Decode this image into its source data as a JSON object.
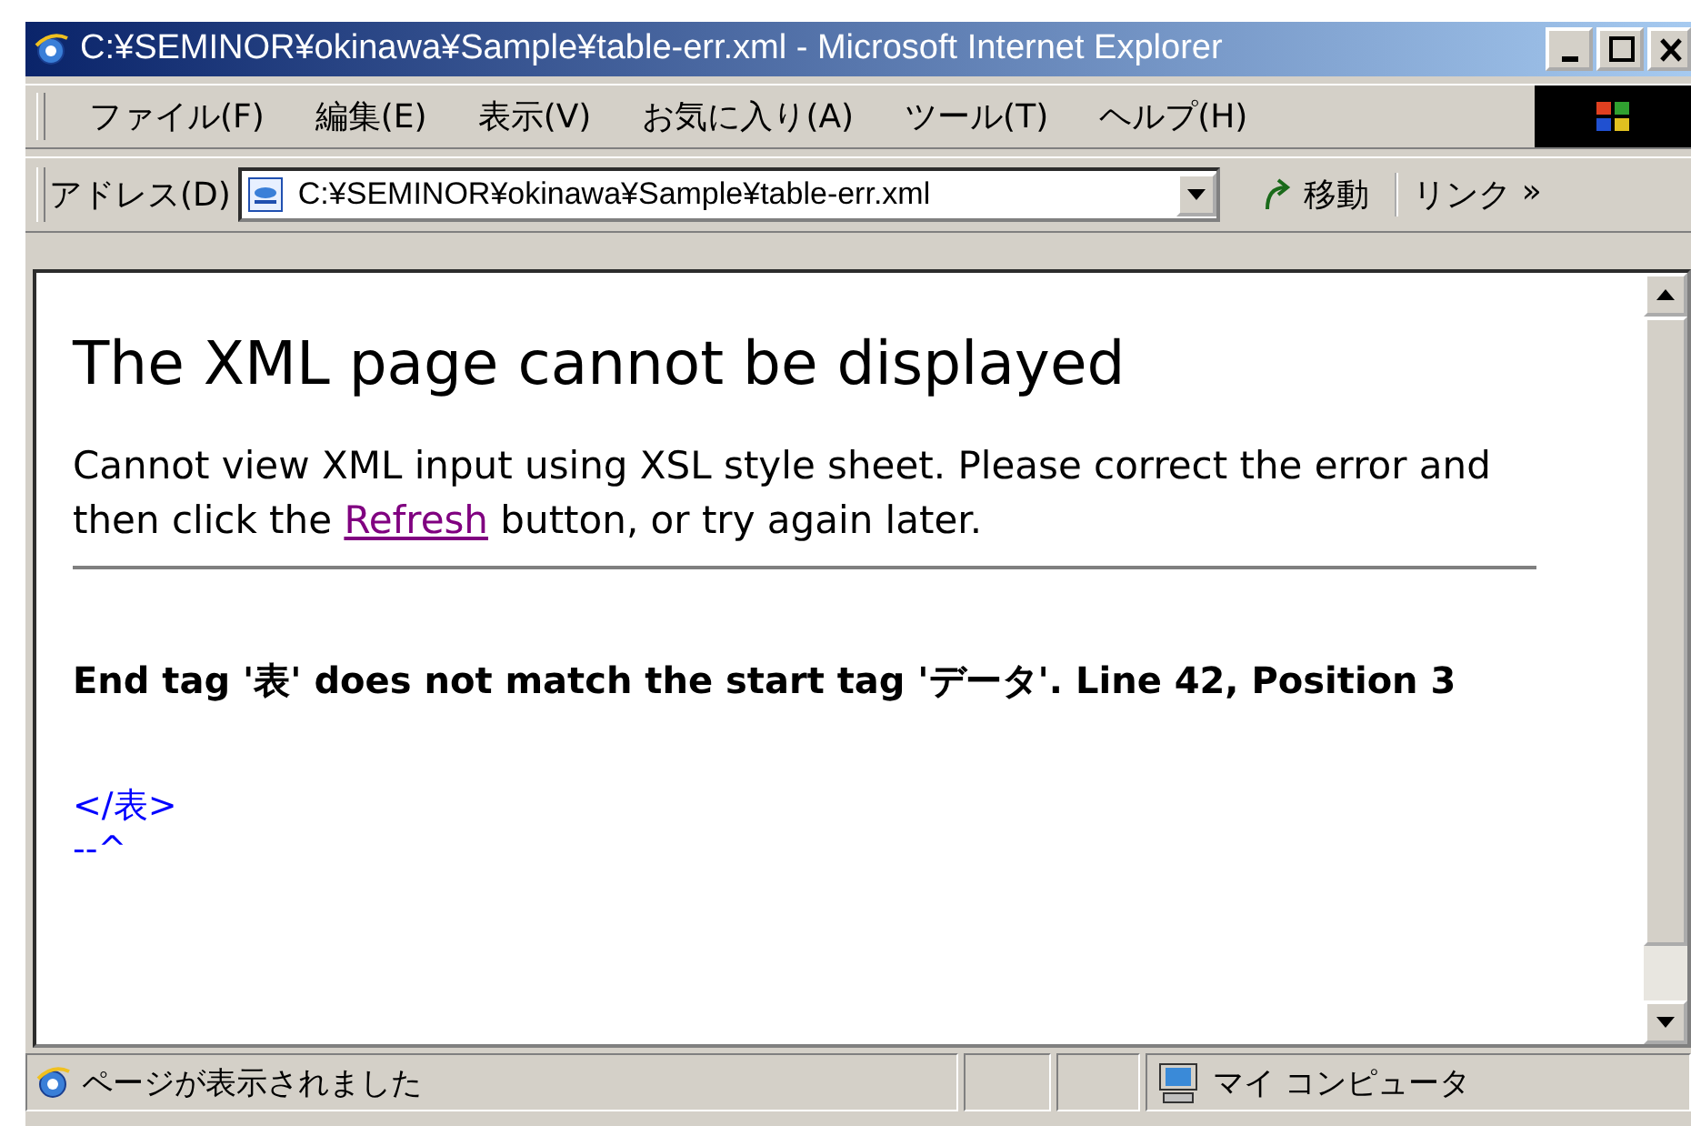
{
  "window": {
    "title": "C:¥SEMINOR¥okinawa¥Sample¥table-err.xml - Microsoft Internet Explorer"
  },
  "menu": [
    "ファイル(F)",
    "編集(E)",
    "表示(V)",
    "お気に入り(A)",
    "ツール(T)",
    "ヘルプ(H)"
  ],
  "address_bar": {
    "label": "アドレス(D)",
    "value": "C:¥SEMINOR¥okinawa¥Sample¥table-err.xml",
    "go": "移動",
    "links": "リンク",
    "more": "»"
  },
  "content": {
    "heading": "The XML page cannot be displayed",
    "message": {
      "before": "Cannot view XML input using XSL style sheet. Please correct the error and then click the",
      "link": "Refresh",
      "after": "button, or try again later."
    },
    "error": "End tag '表' does not match the start tag 'データ'. Line 42, Position 3",
    "source_lines": [
      "</表>",
      "--^"
    ]
  },
  "status_bar": {
    "text": "ページが表示されました",
    "zone": "マイ コンピュータ"
  }
}
